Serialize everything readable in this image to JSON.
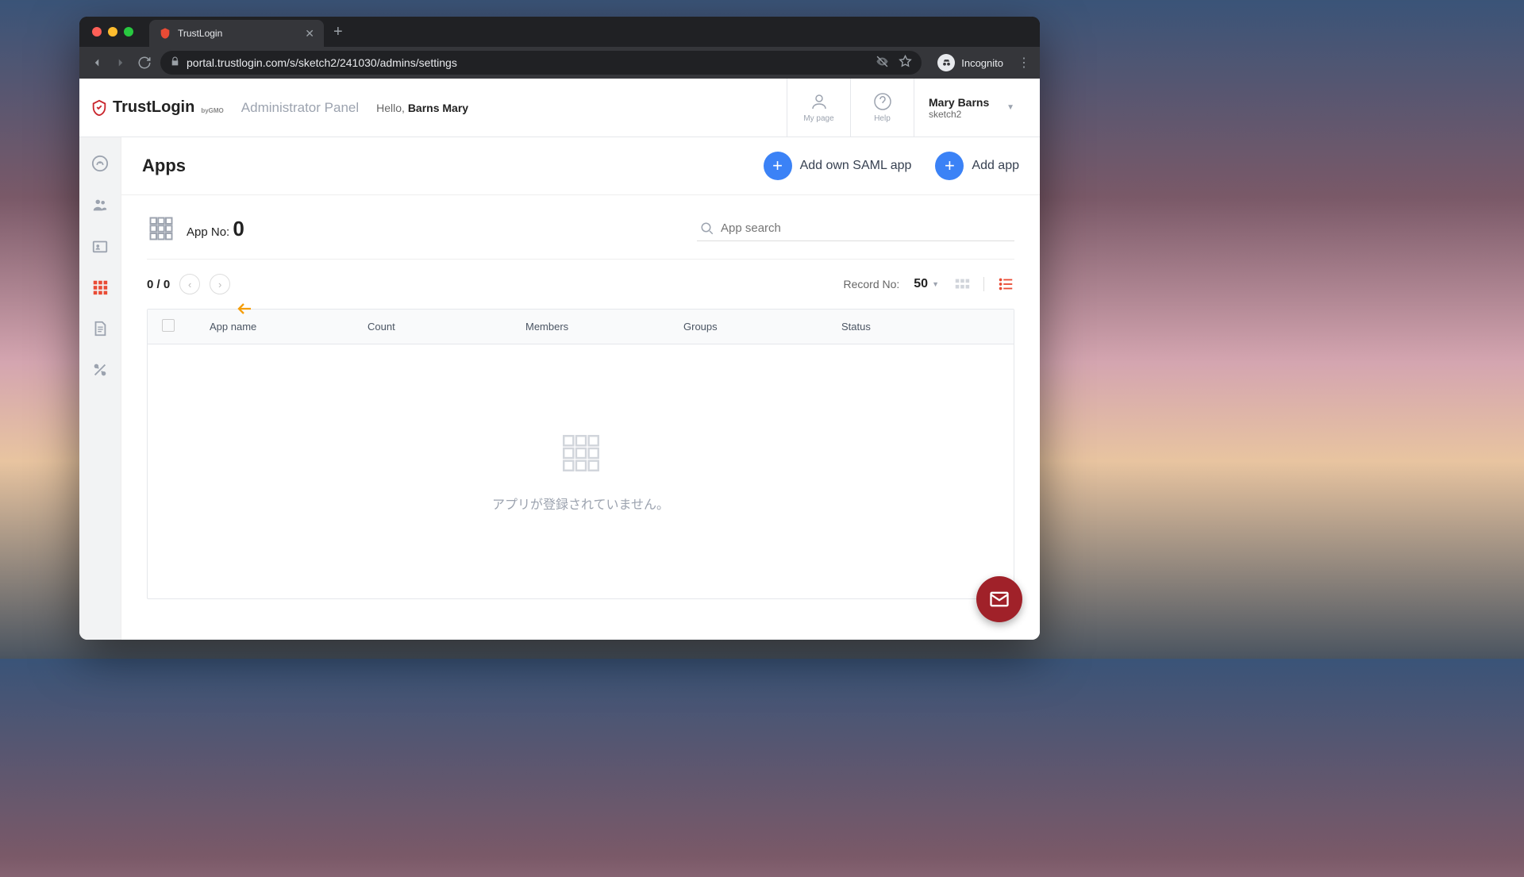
{
  "browser": {
    "tab_title": "TrustLogin",
    "url": "portal.trustlogin.com/s/sketch2/241030/admins/settings",
    "incognito_label": "Incognito"
  },
  "header": {
    "brand": "TrustLogin",
    "brand_sub": "byGMO",
    "panel_label": "Administrator Panel",
    "hello_prefix": "Hello, ",
    "hello_name": "Barns Mary",
    "mypage_label": "My page",
    "help_label": "Help",
    "user_name": "Mary Barns",
    "user_org": "sketch2"
  },
  "page": {
    "title": "Apps",
    "add_saml_label": "Add own SAML app",
    "add_app_label": "Add app",
    "app_no_label": "App No: ",
    "app_no_value": "0",
    "search_placeholder": "App search",
    "pager_text": "0 / 0",
    "record_no_label": "Record No:",
    "record_no_value": "50",
    "columns": {
      "app_name": "App name",
      "count": "Count",
      "members": "Members",
      "groups": "Groups",
      "status": "Status"
    },
    "empty_text": "アプリが登録されていません。"
  }
}
